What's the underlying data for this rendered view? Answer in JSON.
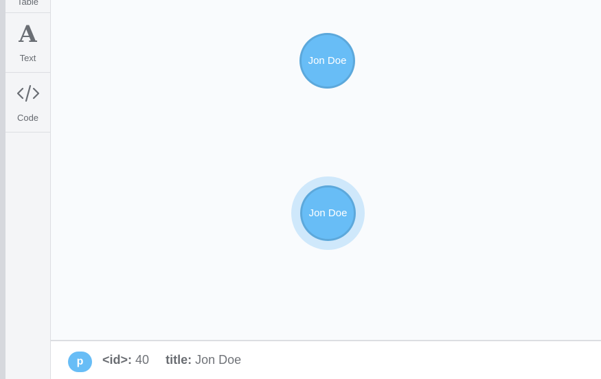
{
  "sidebar": {
    "items": [
      {
        "label": "Table",
        "icon": "table-icon"
      },
      {
        "label": "Text",
        "icon": "text-icon",
        "glyph": "A"
      },
      {
        "label": "Code",
        "icon": "code-icon"
      }
    ]
  },
  "graph": {
    "nodes": [
      {
        "caption": "Jon Doe",
        "selected": false
      },
      {
        "caption": "Jon Doe",
        "selected": true
      }
    ],
    "node_color": "#68bdf6",
    "node_border_color": "#5ca8db",
    "selection_halo_color": "#cfe8fb"
  },
  "status": {
    "badge": "p",
    "id_key": "<id>:",
    "id_value": "40",
    "title_key": "title:",
    "title_value": "Jon Doe"
  }
}
